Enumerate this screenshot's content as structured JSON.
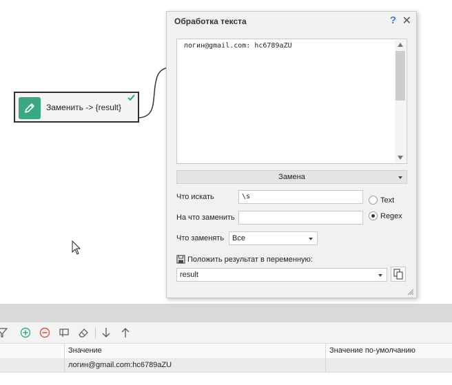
{
  "node": {
    "label": "Заменить -> {result}",
    "icon": "pencil-icon",
    "status_icon": "checkmark-icon",
    "icon_color": "#3aa981"
  },
  "dialog": {
    "title": "Обработка текста",
    "help_label": "?",
    "close_label": "✕",
    "text_content": "логин@gmail.com: hc6789aZU",
    "mode": "Замена",
    "find_label": "Что искать",
    "find_value": "\\s",
    "replace_label": "На что заменить",
    "replace_value": "",
    "radio_text_label": "Text",
    "radio_regex_label": "Regex",
    "selected_radio": "Regex",
    "what_replace_label": "Что заменять",
    "what_replace_value": "Все",
    "save_result_label": "Положить результат в переменную:",
    "result_variable": "result"
  },
  "grid": {
    "columns": [
      "Значение",
      "Значение по-умолчанию"
    ],
    "rows": [
      {
        "value": "логин@gmail.com:hc6789aZU",
        "default": ""
      }
    ]
  },
  "colors": {
    "accent_blue": "#2a82d8",
    "add_green": "#3aa981",
    "remove_red": "#d9534f"
  }
}
